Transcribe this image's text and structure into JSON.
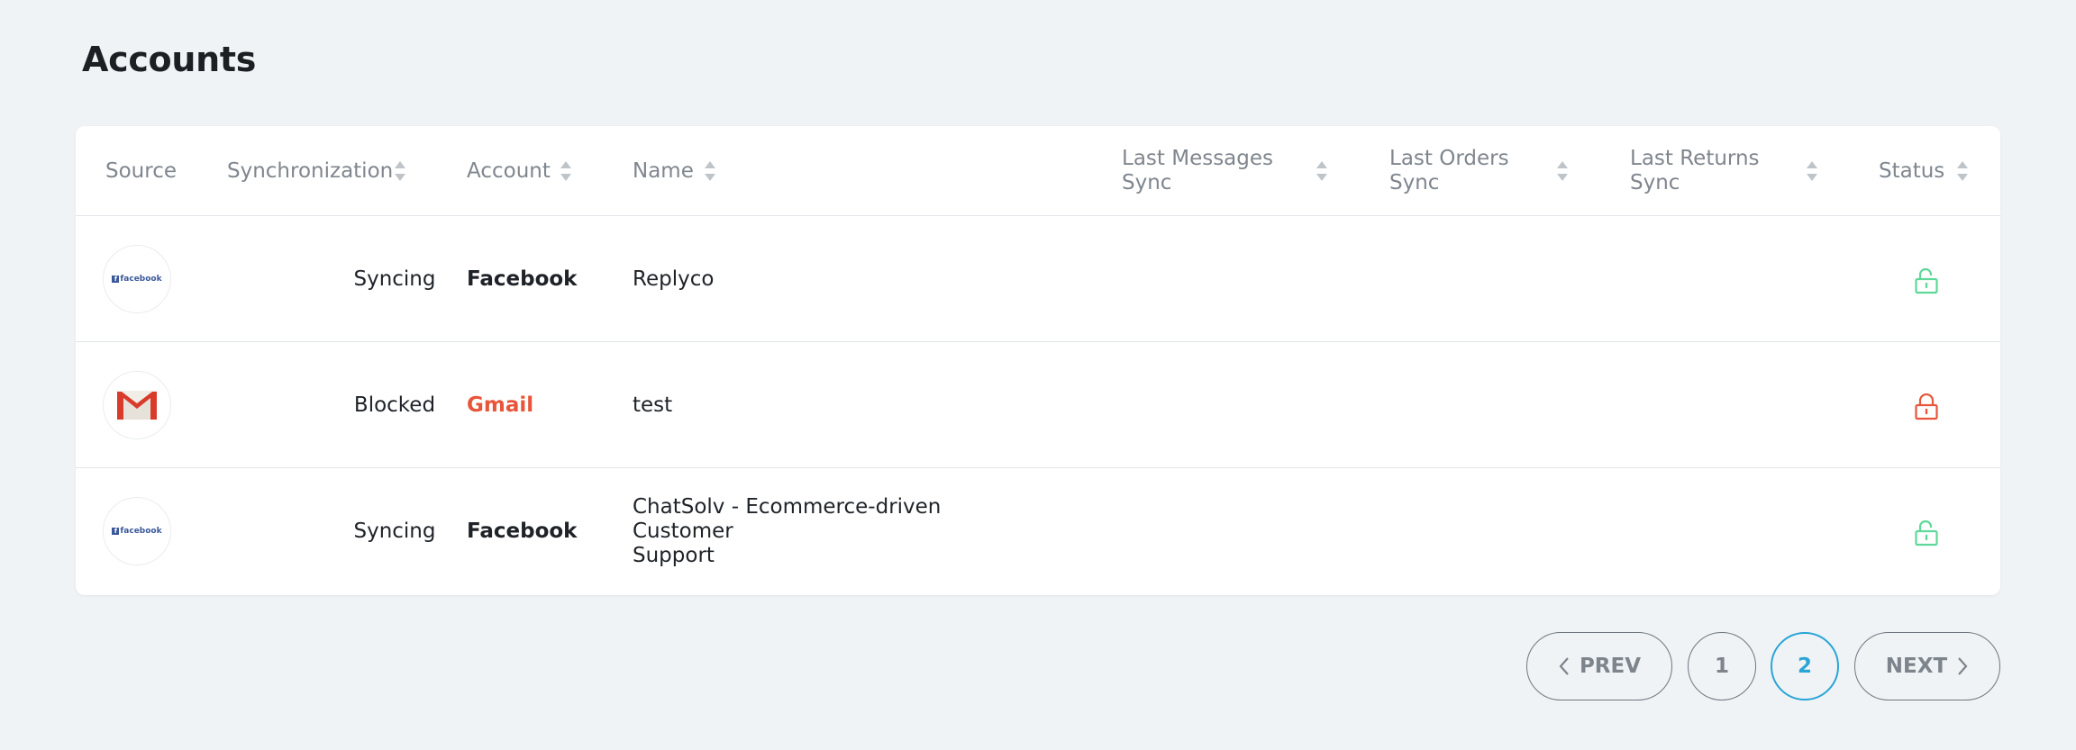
{
  "page": {
    "title": "Accounts"
  },
  "table": {
    "columns": {
      "source": "Source",
      "synchronization": "Synchronization",
      "account": "Account",
      "name": "Name",
      "last_messages_sync_l1": "Last Messages",
      "last_messages_sync_l2": "Sync",
      "last_orders_sync_l1": "Last Orders",
      "last_orders_sync_l2": "Sync",
      "last_returns_sync_l1": "Last Returns",
      "last_returns_sync_l2": "Sync",
      "status": "Status"
    },
    "rows": [
      {
        "source_icon": "facebook-logo",
        "source_logo_text": "facebook",
        "synchronization": "Syncing",
        "account": "Facebook",
        "name_l1": "Replyco",
        "name_l2": "",
        "status_icon": "unlocked-icon"
      },
      {
        "source_icon": "gmail-logo",
        "synchronization": "Blocked",
        "account": "Gmail",
        "name_l1": "test",
        "name_l2": "",
        "status_icon": "locked-icon"
      },
      {
        "source_icon": "facebook-logo",
        "source_logo_text": "facebook",
        "synchronization": "Syncing",
        "account": "Facebook",
        "name_l1": "ChatSolv - Ecommerce-driven Customer",
        "name_l2": "Support",
        "status_icon": "unlocked-icon"
      }
    ]
  },
  "pagination": {
    "prev_label": "PREV",
    "next_label": "NEXT",
    "pages": [
      "1",
      "2"
    ],
    "current_page": "2"
  },
  "colors": {
    "background": "#f0f3f6",
    "unlocked_green": "#5fd89a",
    "locked_red": "#e8553a",
    "active_page_blue": "#2aa5d6",
    "gmail_red": "#e8553a",
    "facebook_blue": "#3b5998"
  }
}
